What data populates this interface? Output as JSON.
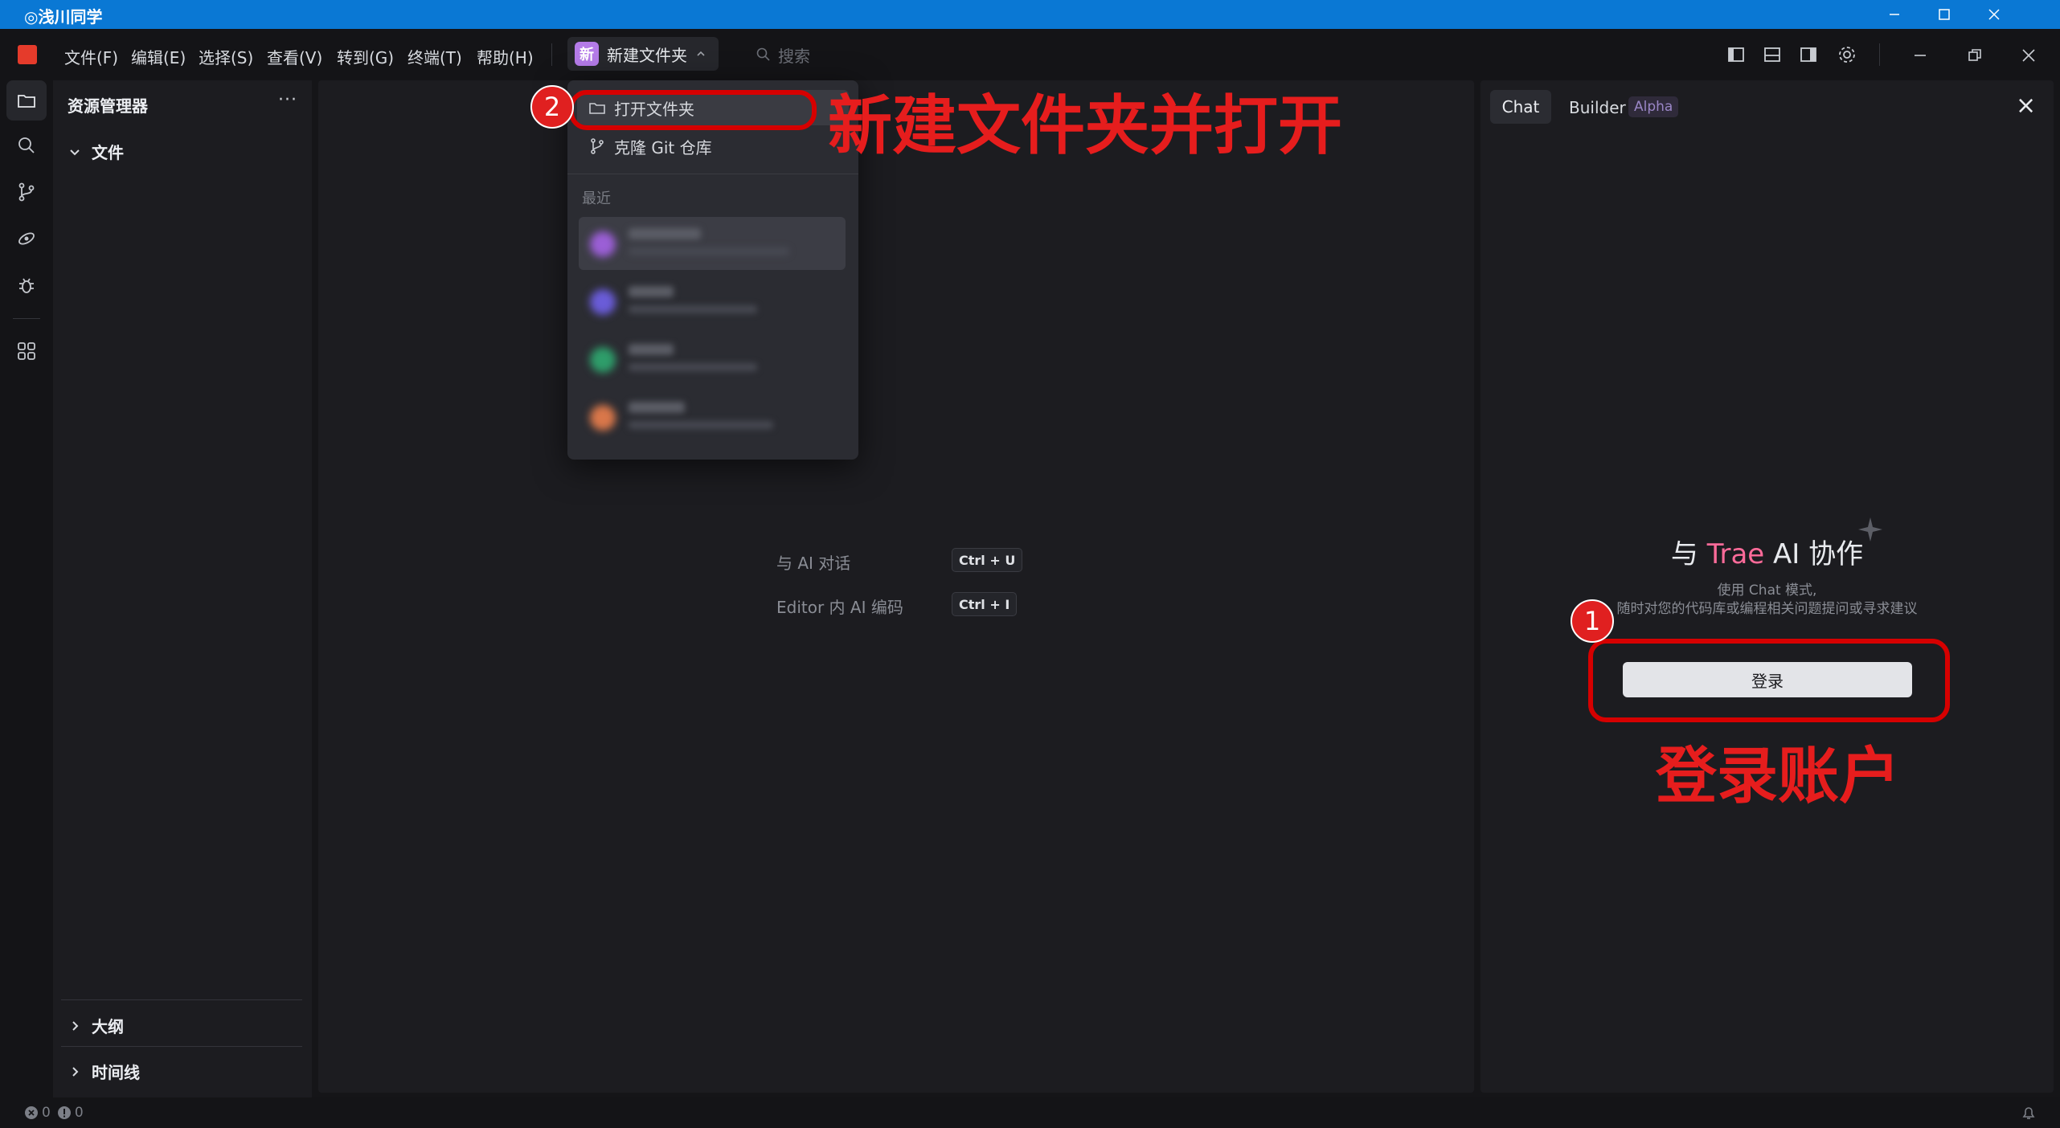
{
  "window": {
    "title": "◎浅川同学"
  },
  "menu": [
    "文件(F)",
    "编辑(E)",
    "选择(S)",
    "查看(V)",
    "转到(G)",
    "终端(T)",
    "帮助(H)"
  ],
  "project": {
    "badge": "新",
    "name": "新建文件夹"
  },
  "search": {
    "placeholder": "搜索"
  },
  "explorer": {
    "title": "资源管理器",
    "more": "···",
    "sections": {
      "files": "文件",
      "outline": "大纲",
      "timeline": "时间线"
    }
  },
  "dropdown": {
    "open_folder": "打开文件夹",
    "clone_git": "克隆 Git 仓库",
    "recent_label": "最近",
    "recent_colors": [
      "#9b5fd6",
      "#6a5cd8",
      "#2e9d6a",
      "#d9774a"
    ]
  },
  "editor": {
    "hints": [
      {
        "label": "与 AI 对话",
        "keys": [
          "Ctrl",
          "+",
          "U"
        ]
      },
      {
        "label": "Editor 内 AI 编码",
        "keys": [
          "Ctrl",
          "+",
          "I"
        ]
      }
    ]
  },
  "chat_panel": {
    "tab_chat": "Chat",
    "tab_builder": "Builder",
    "builder_badge": "Alpha",
    "welcome_prefix": "与 ",
    "welcome_brand": "Trae",
    "welcome_suffix": " AI 协作",
    "subtitle1": "使用 Chat 模式,",
    "subtitle2": "随时对您的代码库或编程相关问题提问或寻求建议",
    "login_button": "登录",
    "close": "×"
  },
  "status": {
    "errors": "0",
    "warnings": "0"
  },
  "annotations": {
    "step1": "1",
    "step2": "2",
    "caption_top": "新建文件夹并打开",
    "caption_login": "登录账户"
  },
  "colors": {
    "accent_red": "#e61d1d",
    "brand_pink": "#ff6b9a",
    "titlebar_blue": "#0a78d4"
  }
}
